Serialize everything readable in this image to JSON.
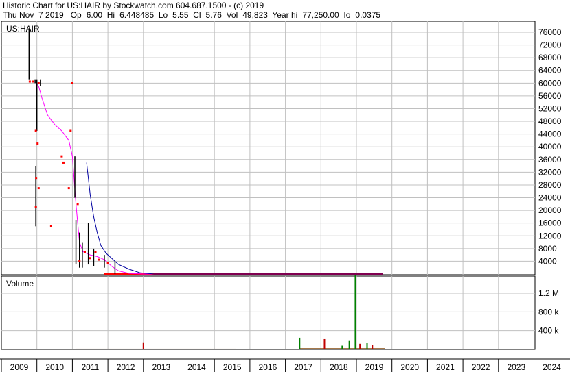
{
  "header": {
    "line1": "Historic Chart for US:HAIR by Stockwatch.com 604.687.1500 - (c) 2019",
    "line2": "Thu Nov  7 2019   Op=6.00  Hi=6.448485  Lo=5.55  Cl=5.76  Vol=49,823  Year hi=77,250.00  Io=0.0375"
  },
  "colors": {
    "price": "#000000",
    "price_markers": "#ff0000",
    "ma_short": "#ff00ff",
    "ma_long": "#0000a0",
    "volume_up": "#008000",
    "volume_down": "#c00000",
    "grid": "#c0c0c0"
  },
  "chart_data": [
    {
      "type": "line",
      "title": "US:HAIR",
      "ylim": [
        0,
        80000
      ],
      "y_ticks": [
        "76000",
        "72000",
        "68000",
        "64000",
        "60000",
        "56000",
        "52000",
        "48000",
        "44000",
        "40000",
        "36000",
        "32000",
        "28000",
        "24000",
        "20000",
        "16000",
        "12000",
        "8000",
        "4000"
      ],
      "x_ticks": [
        "2009",
        "2010",
        "2011",
        "2012",
        "2013",
        "2014",
        "2015",
        "2016",
        "2017",
        "2018",
        "2019",
        "2020",
        "2021",
        "2022",
        "2023",
        "2024"
      ],
      "price_bars": [
        {
          "x": 2009.78,
          "high": 77250,
          "low": 61000
        },
        {
          "x": 2009.95,
          "high": 61000,
          "low": 60000
        },
        {
          "x": 2010.1,
          "high": 61000,
          "low": 59000
        },
        {
          "x": 2009.97,
          "high": 34000,
          "low": 15000
        },
        {
          "x": 2010.0,
          "high": 61000,
          "low": 45000
        },
        {
          "x": 2011.07,
          "high": 37000,
          "low": 24000
        },
        {
          "x": 2011.1,
          "high": 17000,
          "low": 3000
        },
        {
          "x": 2011.2,
          "high": 13000,
          "low": 2000
        },
        {
          "x": 2011.28,
          "high": 10000,
          "low": 2000
        },
        {
          "x": 2011.45,
          "high": 16000,
          "low": 3000
        },
        {
          "x": 2011.6,
          "high": 8000,
          "low": 2500
        },
        {
          "x": 2011.9,
          "high": 6000,
          "low": 2000
        },
        {
          "x": 2012.2,
          "high": 4000,
          "low": 0
        }
      ],
      "close_markers": [
        {
          "x": 2009.8,
          "y": 60500
        },
        {
          "x": 2009.9,
          "y": 60500
        },
        {
          "x": 2010.05,
          "y": 60000
        },
        {
          "x": 2009.97,
          "y": 45000
        },
        {
          "x": 2010.02,
          "y": 41000
        },
        {
          "x": 2009.98,
          "y": 30000
        },
        {
          "x": 2010.05,
          "y": 27000
        },
        {
          "x": 2009.97,
          "y": 21000
        },
        {
          "x": 2010.4,
          "y": 15000
        },
        {
          "x": 2010.7,
          "y": 37000
        },
        {
          "x": 2010.75,
          "y": 35000
        },
        {
          "x": 2010.95,
          "y": 45000
        },
        {
          "x": 2011.0,
          "y": 60000
        },
        {
          "x": 2010.9,
          "y": 27000
        },
        {
          "x": 2011.15,
          "y": 22000
        },
        {
          "x": 2011.2,
          "y": 4000
        },
        {
          "x": 2011.35,
          "y": 7000
        },
        {
          "x": 2011.5,
          "y": 5000
        },
        {
          "x": 2011.65,
          "y": 7000
        },
        {
          "x": 2011.75,
          "y": 4500
        },
        {
          "x": 2012.0,
          "y": 3500
        }
      ],
      "series": [
        {
          "values": [
            [
              2009.95,
              60500
            ],
            [
              2010.05,
              59000
            ],
            [
              2010.15,
              55000
            ],
            [
              2010.3,
              50000
            ],
            [
              2010.5,
              47000
            ],
            [
              2010.7,
              45000
            ],
            [
              2010.9,
              42000
            ],
            [
              2011.0,
              37000
            ],
            [
              2011.1,
              22000
            ],
            [
              2011.2,
              10000
            ],
            [
              2011.3,
              7000
            ],
            [
              2011.5,
              6000
            ],
            [
              2011.7,
              5500
            ],
            [
              2011.9,
              4500
            ],
            [
              2012.1,
              2500
            ],
            [
              2012.3,
              1000
            ],
            [
              2012.6,
              200
            ],
            [
              2013.0,
              0
            ],
            [
              2019.75,
              0
            ]
          ]
        },
        {
          "values": [
            [
              2011.4,
              35000
            ],
            [
              2011.5,
              25000
            ],
            [
              2011.6,
              18000
            ],
            [
              2011.7,
              13000
            ],
            [
              2011.8,
              9000
            ],
            [
              2011.95,
              6500
            ],
            [
              2012.1,
              5000
            ],
            [
              2012.3,
              3000
            ],
            [
              2012.6,
              1500
            ],
            [
              2012.9,
              400
            ],
            [
              2013.3,
              0
            ],
            [
              2019.75,
              0
            ]
          ]
        }
      ]
    },
    {
      "type": "bar",
      "title": "Volume",
      "ylim": [
        0,
        1600000
      ],
      "y_ticks": [
        "1.2 M",
        "800 k",
        "400 k"
      ],
      "spikes": [
        {
          "x": 2013.0,
          "value": 150000,
          "color": "down"
        },
        {
          "x": 2017.4,
          "value": 250000,
          "color": "up"
        },
        {
          "x": 2018.1,
          "value": 220000,
          "color": "down"
        },
        {
          "x": 2018.6,
          "value": 80000,
          "color": "up"
        },
        {
          "x": 2018.8,
          "value": 180000,
          "color": "up"
        },
        {
          "x": 2018.97,
          "value": 1580000,
          "color": "up"
        },
        {
          "x": 2019.1,
          "value": 120000,
          "color": "down"
        },
        {
          "x": 2019.3,
          "value": 140000,
          "color": "up"
        },
        {
          "x": 2019.45,
          "value": 90000,
          "color": "down"
        }
      ]
    }
  ]
}
